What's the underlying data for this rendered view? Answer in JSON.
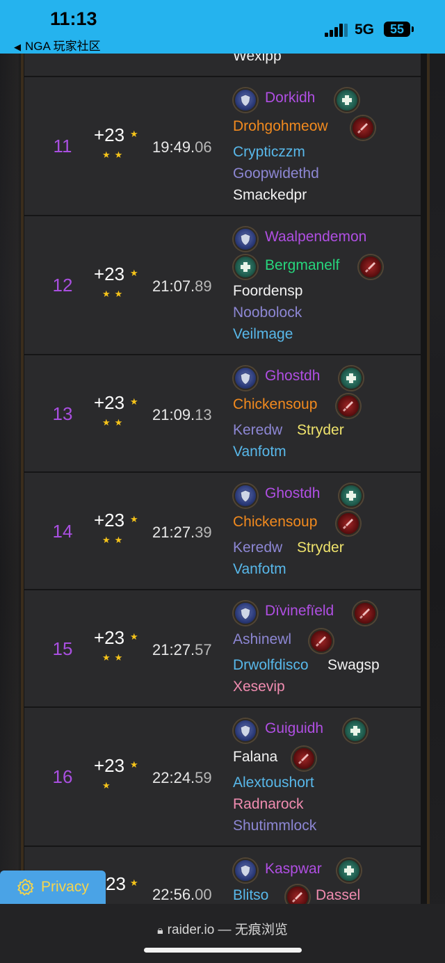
{
  "status_bar": {
    "time": "11:13",
    "back_label": "NGA 玩家社区",
    "network": "5G",
    "battery": "55",
    "accent": "#25b3ee"
  },
  "top_partial": {
    "name": "Wexipp",
    "color": "#ffffff"
  },
  "rows": [
    {
      "rank": "11",
      "level": "+23",
      "stars": "★★",
      "time_main": "19:49.",
      "time_ms": "06",
      "members": [
        {
          "name": "Dorkidh",
          "color": "#b04fe3"
        },
        {
          "name": "Drohgohmeow",
          "color": "#f28a1e"
        },
        {
          "name": "Crypticzzm",
          "color": "#58b8ea"
        },
        {
          "name": "Goopwidethd",
          "color": "#8d87d4"
        },
        {
          "name": "Smackedpr",
          "color": "#f3f3f3"
        }
      ]
    },
    {
      "rank": "12",
      "level": "+23",
      "stars": "★★",
      "time_main": "21:07.",
      "time_ms": "89",
      "members": [
        {
          "name": "Waalpendemon",
          "color": "#b04fe3"
        },
        {
          "name": "Bergmanelf",
          "color": "#27d67d"
        },
        {
          "name": "Foordensp",
          "color": "#f3f3f3"
        },
        {
          "name": "Noobolock",
          "color": "#8d87d4"
        },
        {
          "name": "Veilmage",
          "color": "#58b8ea"
        }
      ]
    },
    {
      "rank": "13",
      "level": "+23",
      "stars": "★★",
      "time_main": "21:09.",
      "time_ms": "13",
      "members": [
        {
          "name": "Ghostdh",
          "color": "#b04fe3"
        },
        {
          "name": "Chickensoup",
          "color": "#f28a1e"
        },
        {
          "name": "Keredw",
          "color": "#8d87d4"
        },
        {
          "name": "Stryder",
          "color": "#efe36c"
        },
        {
          "name": "Vanfotm",
          "color": "#58b8ea"
        }
      ]
    },
    {
      "rank": "14",
      "level": "+23",
      "stars": "★★",
      "time_main": "21:27.",
      "time_ms": "39",
      "members": [
        {
          "name": "Ghostdh",
          "color": "#b04fe3"
        },
        {
          "name": "Chickensoup",
          "color": "#f28a1e"
        },
        {
          "name": "Keredw",
          "color": "#8d87d4"
        },
        {
          "name": "Stryder",
          "color": "#efe36c"
        },
        {
          "name": "Vanfotm",
          "color": "#58b8ea"
        }
      ]
    },
    {
      "rank": "15",
      "level": "+23",
      "stars": "★★",
      "time_main": "21:27.",
      "time_ms": "57",
      "members": [
        {
          "name": "Dïvinefïeld",
          "color": "#b04fe3"
        },
        {
          "name": "Ashinewl",
          "color": "#8d87d4"
        },
        {
          "name": "Drwolfdisco",
          "color": "#58b8ea"
        },
        {
          "name": "Swagsp",
          "color": "#f3f3f3"
        },
        {
          "name": "Xesevip",
          "color": "#f08cb0"
        }
      ]
    },
    {
      "rank": "16",
      "level": "+23",
      "stars": "★",
      "time_main": "22:24.",
      "time_ms": "59",
      "members": [
        {
          "name": "Guiguidh",
          "color": "#b04fe3"
        },
        {
          "name": "Falana",
          "color": "#f3f3f3"
        },
        {
          "name": "Alextoushort",
          "color": "#58b8ea"
        },
        {
          "name": "Radnarock",
          "color": "#f08cb0"
        },
        {
          "name": "Shutimmlock",
          "color": "#8d87d4"
        }
      ]
    },
    {
      "rank": "",
      "level": "23",
      "stars": "",
      "time_main": "22:56.",
      "time_ms": "00",
      "members": [
        {
          "name": "Kaspwar",
          "color": "#b04fe3"
        },
        {
          "name": "Blitso",
          "color": "#58b8ea"
        },
        {
          "name": "Dassel",
          "color": "#f08cb0"
        }
      ]
    }
  ],
  "privacy": {
    "label": "Privacy",
    "icon": "gear-icon"
  },
  "browser": {
    "url": "raider.io — 无痕浏览",
    "icon": "lock-icon"
  }
}
